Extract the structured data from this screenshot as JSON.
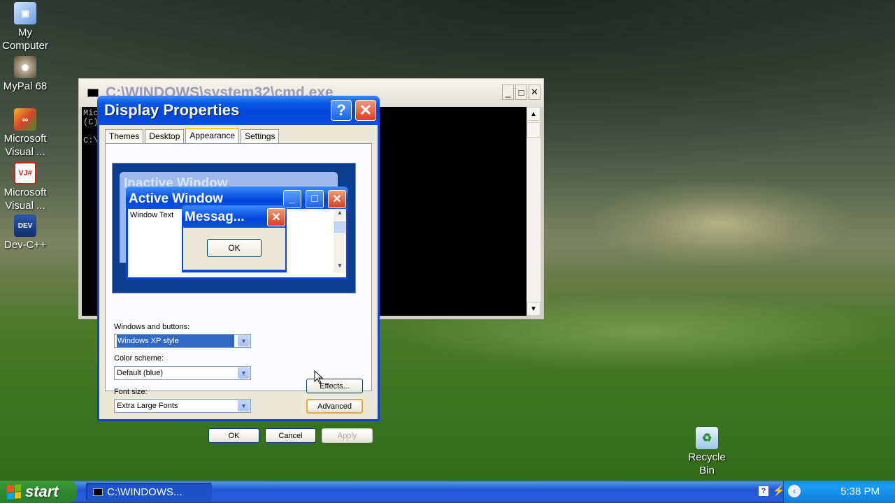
{
  "desktop": {
    "icons": [
      {
        "label": "My Computer",
        "icon": "my-computer-icon"
      },
      {
        "label": "MyPal 68",
        "icon": "mypal-icon"
      },
      {
        "label": "Microsoft Visual ...",
        "icon": "visual-studio-icon"
      },
      {
        "label": "Microsoft Visual ...",
        "icon": "visual-j-icon"
      },
      {
        "label": "Dev-C++",
        "icon": "dev-cpp-icon"
      },
      {
        "label": "Recycle Bin",
        "icon": "recycle-bin-icon"
      }
    ]
  },
  "cmd": {
    "title": "C:\\WINDOWS\\system32\\cmd.exe",
    "lines": [
      "Mic",
      "(C)",
      "",
      "C:\\"
    ]
  },
  "dialog": {
    "title": "Display Properties",
    "tabs": [
      "Themes",
      "Desktop",
      "Appearance",
      "Settings"
    ],
    "preview": {
      "inactive_title": "Inactive Window",
      "active_title": "Active Window",
      "window_text": "Window Text",
      "message_title": "Messag...",
      "ok": "OK"
    },
    "windows_buttons_label": "Windows and buttons:",
    "windows_buttons_value": "Windows XP style",
    "color_scheme_label": "Color scheme:",
    "color_scheme_value": "Default (blue)",
    "font_size_label": "Font size:",
    "font_size_value": "Extra Large Fonts",
    "effects": "Effects...",
    "advanced": "Advanced",
    "ok": "OK",
    "cancel": "Cancel",
    "apply": "Apply"
  },
  "taskbar": {
    "start": "start",
    "task": "C:\\WINDOWS...",
    "clock": "5:38 PM"
  }
}
